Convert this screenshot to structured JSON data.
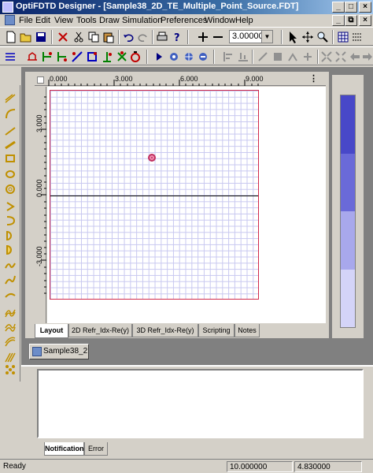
{
  "window": {
    "title": "OptiFDTD Designer - [Sample38_2D_TE_Multiple_Point_Source.FDT]",
    "buttons": [
      "_",
      "□",
      "×"
    ],
    "mdi_buttons": [
      "_",
      "⧉",
      "×"
    ]
  },
  "menu": [
    "File",
    "Edit",
    "View",
    "Tools",
    "Draw",
    "Simulation",
    "Preferences",
    "Window",
    "Help"
  ],
  "toolbar": {
    "zoom_value": "3.00000",
    "zoom_dropdown_glyph": "▼"
  },
  "ruler": {
    "h_labels": [
      "0.000",
      "3.000",
      "6.000",
      "9.000"
    ],
    "v_labels": [
      "3.000",
      "0.000",
      "-3.000"
    ]
  },
  "view_tabs": [
    {
      "label": "Layout",
      "active": true
    },
    {
      "label": "2D Refr_Idx-Re(y)",
      "active": false
    },
    {
      "label": "3D Refr_Idx-Re(y)",
      "active": false
    },
    {
      "label": "Scripting",
      "active": false
    },
    {
      "label": "Notes",
      "active": false
    }
  ],
  "scale_colors": [
    "#4848c8",
    "#6a6ad8",
    "#a8a8ec",
    "#d4d4f8"
  ],
  "document_tab": "Sample38_2...",
  "notification_tabs": [
    {
      "label": "Notification",
      "active": true
    },
    {
      "label": "Error",
      "active": false
    }
  ],
  "status": {
    "left": "Ready",
    "x": "10.000000",
    "y": "4.830000"
  },
  "colors": {
    "title_gradient_start": "#0a246a",
    "grid_border": "#d22a4a",
    "grid_line": "#c8c8f0",
    "source": "#c03060"
  }
}
